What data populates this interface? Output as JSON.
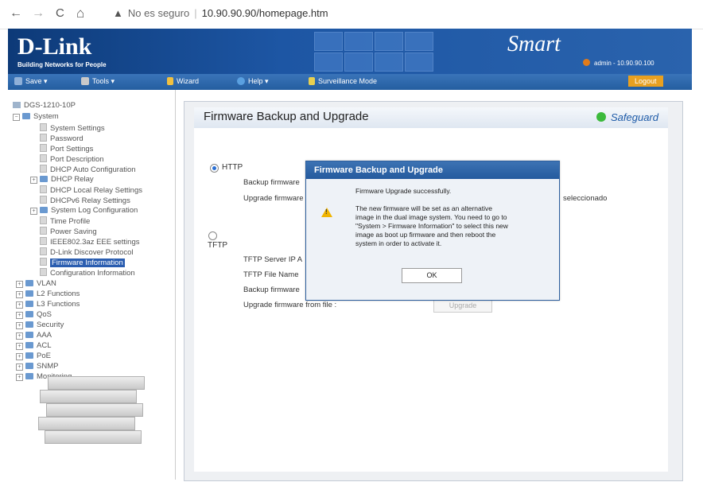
{
  "browser": {
    "back": "←",
    "forward": "→",
    "reload": "C",
    "home": "⌂",
    "security_label": "No es seguro",
    "url": "10.90.90.90/homepage.htm"
  },
  "header": {
    "logo": "D-Link",
    "tagline": "Building Networks for People",
    "brand": "Smart",
    "user": "admin - 10.90.90.100"
  },
  "menubar": {
    "save": "Save ▾",
    "tools": "Tools ▾",
    "wizard": "Wizard",
    "help": "Help ▾",
    "surveillance": "Surveillance Mode",
    "logout": "Logout"
  },
  "sidebar": {
    "device": "DGS-1210-10P",
    "system": "System",
    "items": [
      "System Settings",
      "Password",
      "Port Settings",
      "Port Description",
      "DHCP Auto Configuration",
      "DHCP Relay",
      "DHCP Local Relay Settings",
      "DHCPv6 Relay Settings",
      "System Log Configuration",
      "Time Profile",
      "Power Saving",
      "IEEE802.3az EEE settings",
      "D-Link Discover Protocol",
      "Firmware Information",
      "Configuration Information"
    ],
    "groups": [
      "VLAN",
      "L2 Functions",
      "L3 Functions",
      "QoS",
      "Security",
      "AAA",
      "ACL",
      "PoE",
      "SNMP",
      "Monitoring"
    ]
  },
  "panel": {
    "title": "Firmware Backup and Upgrade",
    "safeguard": "Safeguard",
    "http_label": "HTTP",
    "backup_firmware": "Backup firmware",
    "upgrade_firmware": "Upgrade firmware",
    "file_status": "seleccionado",
    "tftp_label": "TFTP",
    "tftp_server": "TFTP Server IP A",
    "tftp_file_name": "TFTP File Name",
    "backup_firmware_tftp": "Backup firmware",
    "upgrade_from_file": "Upgrade firmware from file :",
    "upgrade_button": "Upgrade"
  },
  "dialog": {
    "title": "Firmware Backup and Upgrade",
    "line1": "Firmware Upgrade successfully.",
    "line2": "The new firmware will be set as an alternative",
    "line3": "image in the dual image system. You need to go to",
    "line4": "\"System > Firmware Information\" to select this new",
    "line5": "image as boot up firmware and then reboot the",
    "line6": "system in order to activate it.",
    "ok": "OK"
  },
  "colors": {
    "header": "#1d56a4",
    "menubar": "#2a65aa",
    "logout": "#e8a020",
    "safeguard": "#3cba3c",
    "dialog_title": "#2d5f9e"
  }
}
